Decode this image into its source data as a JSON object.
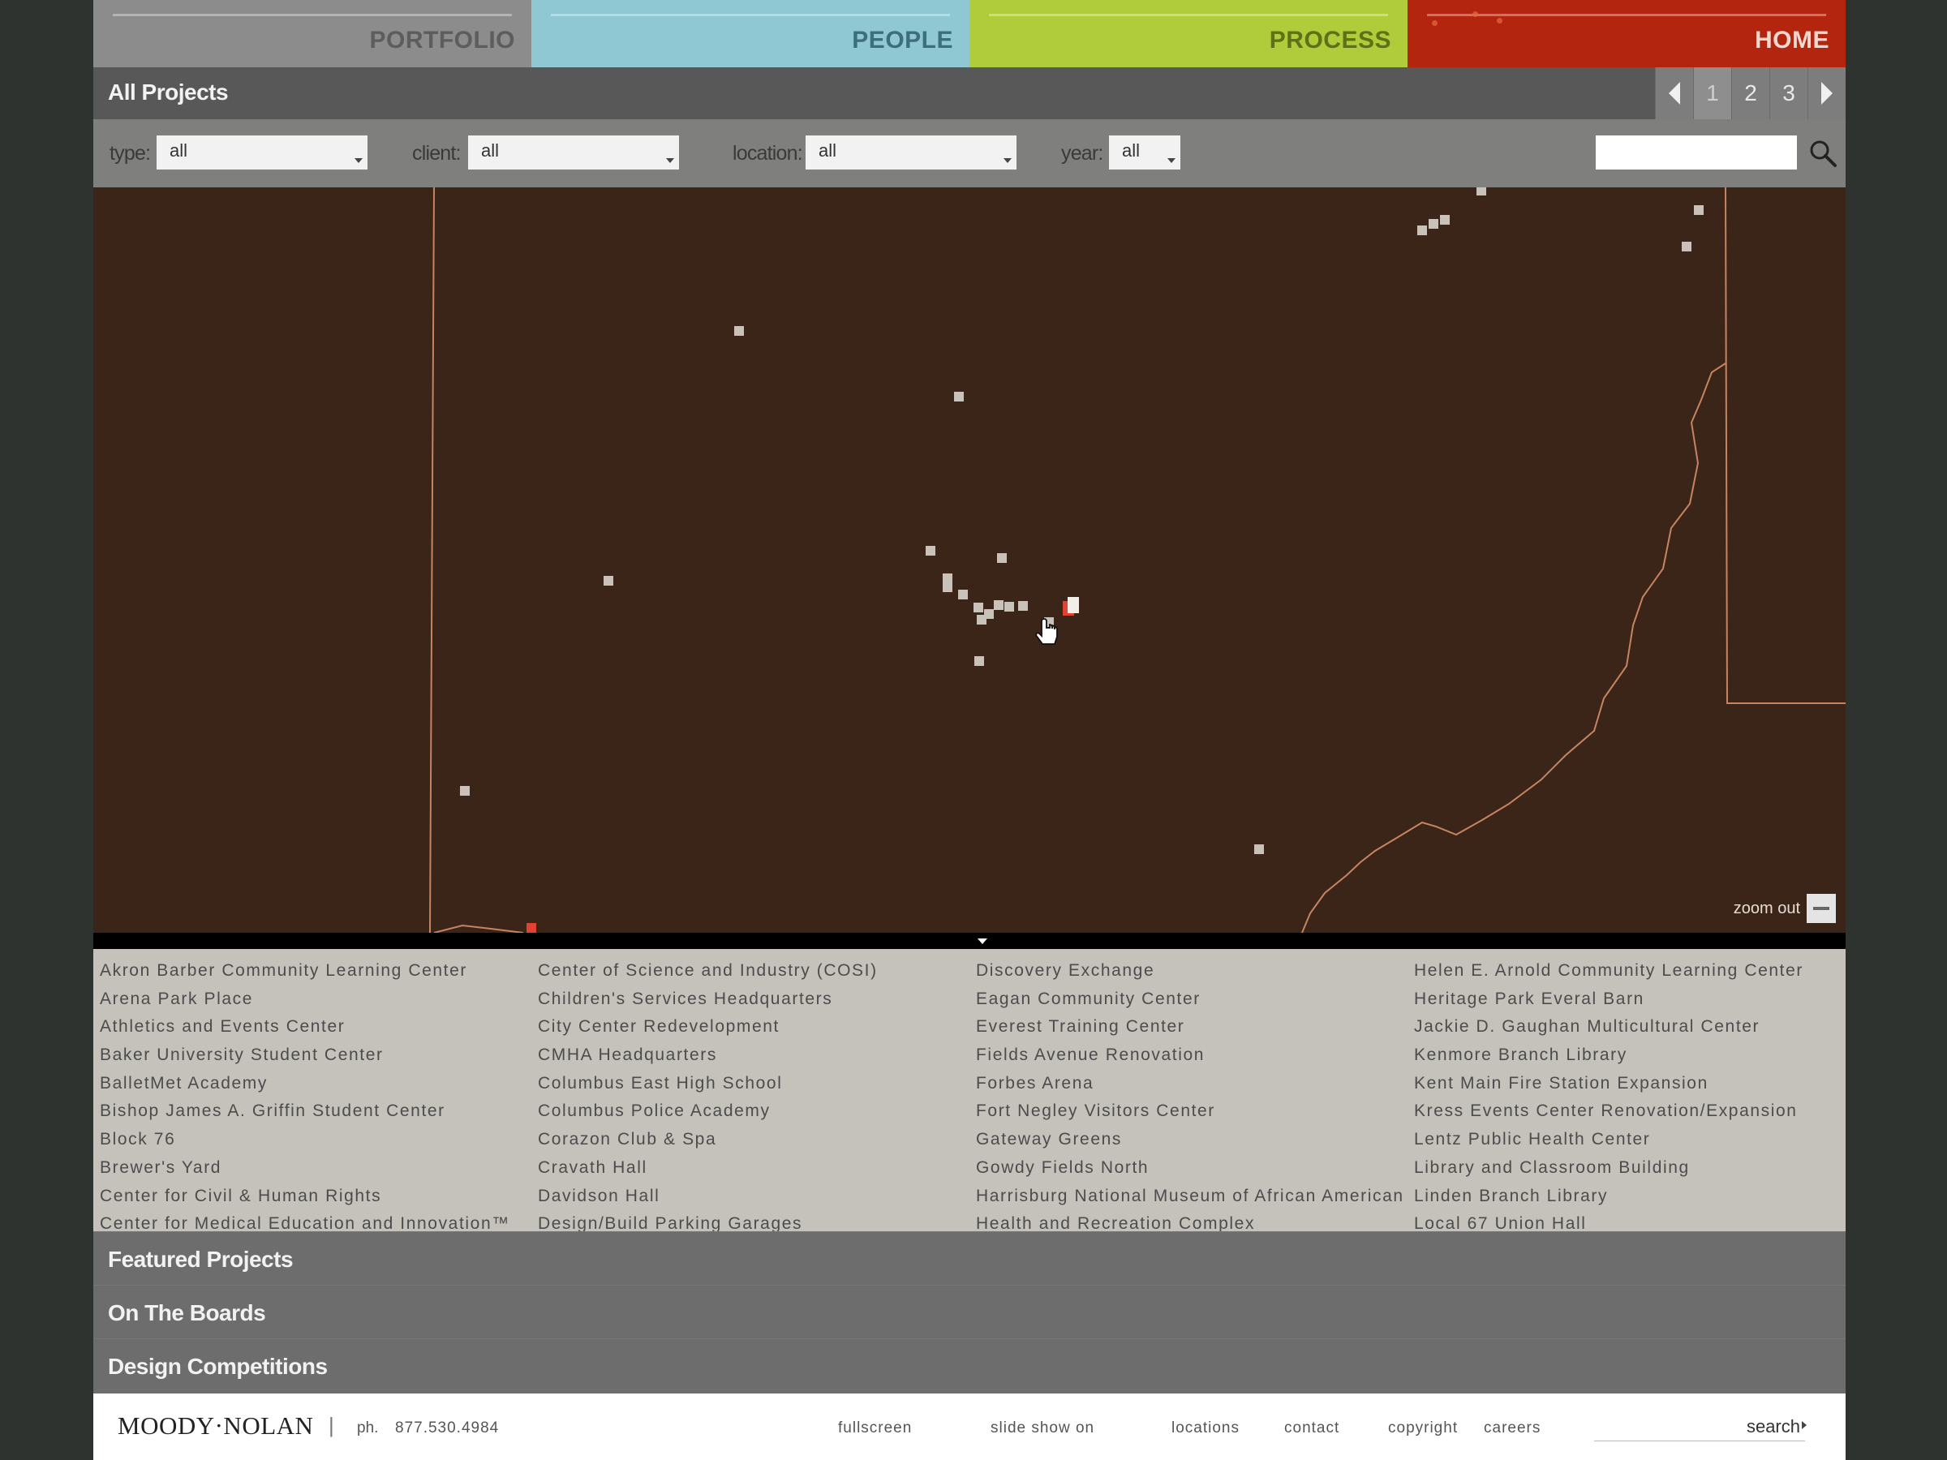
{
  "nav": {
    "tabs": [
      {
        "label": "PORTFOLIO",
        "color": "#8c8c8c"
      },
      {
        "label": "PEOPLE",
        "color": "#8fc8d3"
      },
      {
        "label": "PROCESS",
        "color": "#b1cc3b"
      },
      {
        "label": "HOME",
        "color": "#b3250f"
      }
    ]
  },
  "header": {
    "title": "All Projects",
    "pages": [
      "1",
      "2",
      "3"
    ],
    "current_page": "1"
  },
  "filters": {
    "type": {
      "label": "type:",
      "value": "all"
    },
    "client": {
      "label": "client:",
      "value": "all"
    },
    "location": {
      "label": "location:",
      "value": "all"
    },
    "year": {
      "label": "year:",
      "value": "all"
    },
    "search_value": ""
  },
  "map": {
    "zoom_label": "zoom out",
    "background": "#3b2418"
  },
  "projects": {
    "columns": [
      [
        "Akron Barber Community Learning Center",
        "Arena Park Place",
        "Athletics and Events Center",
        "Baker University Student Center",
        "BalletMet Academy",
        "Bishop James A. Griffin Student Center",
        "Block 76",
        "Brewer's Yard",
        "Center for Civil & Human Rights",
        "Center for Medical Education and Innovation™"
      ],
      [
        "Center of Science and Industry (COSI)",
        "Children's Services Headquarters",
        "City Center Redevelopment",
        "CMHA Headquarters",
        "Columbus East High School",
        "Columbus Police Academy",
        "Corazon Club & Spa",
        "Cravath Hall",
        "Davidson Hall",
        "Design/Build Parking Garages"
      ],
      [
        "Discovery Exchange",
        "Eagan Community Center",
        "Everest Training Center",
        "Fields Avenue Renovation",
        "Forbes Arena",
        "Fort Negley Visitors Center",
        "Gateway Greens",
        "Gowdy Fields North",
        "Harrisburg National Museum of African American",
        "Health and Recreation Complex"
      ],
      [
        "Helen E. Arnold Community Learning Center",
        "Heritage Park Everal Barn",
        "Jackie D. Gaughan Multicultural Center",
        "Kenmore Branch Library",
        "Kent Main Fire Station Expansion",
        "Kress Events Center Renovation/Expansion",
        "Lentz Public Health Center",
        "Library and Classroom Building",
        "Linden Branch Library",
        "Local 67 Union Hall"
      ]
    ]
  },
  "sections": [
    "Featured Projects",
    "On The Boards",
    "Design Competitions"
  ],
  "footer": {
    "logo": "MOODY·NOLAN",
    "separator": "|",
    "phone_label": "ph.",
    "phone": "877.530.4984",
    "links": [
      "fullscreen",
      "slide show on",
      "locations",
      "contact",
      "copyright",
      "careers"
    ],
    "search_label": "search"
  }
}
